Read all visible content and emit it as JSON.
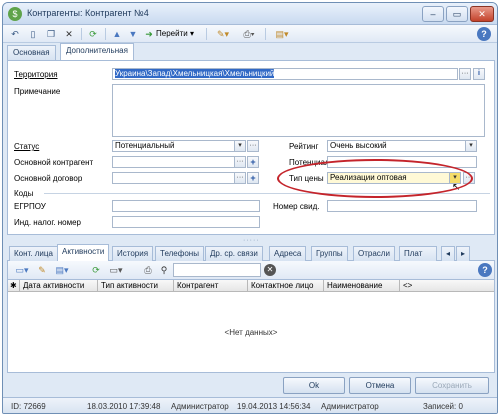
{
  "window": {
    "title": "Контрагенты: Контрагент №4",
    "minimize": "–",
    "maximize": "▭",
    "close": "✕"
  },
  "toolbar": {
    "goto_label": "Перейти",
    "dropdown": "▾"
  },
  "tabs": [
    {
      "label": "Основная"
    },
    {
      "label": "Дополнительная"
    }
  ],
  "form": {
    "territory_label": "Территория",
    "territory_value": "Украина\\Запад\\Хмельницкая\\Хмельницкий",
    "note_label": "Примечание",
    "status_label": "Статус",
    "status_value": "Потенциальный",
    "rating_label": "Рейтинг",
    "rating_value": "Очень высокий",
    "main_contractor_label": "Основной контрагент",
    "potential_label": "Потенциал",
    "main_contract_label": "Основной договор",
    "price_type_label": "Тип цены",
    "price_type_value": "Реализации оптовая",
    "codes_label": "Коды",
    "egrpou_label": "ЕГРПОУ",
    "cert_label": "Номер свид.",
    "tax_label": "Инд. налог. номер"
  },
  "bottom_tabs": [
    {
      "label": "Конт. лица"
    },
    {
      "label": "Активности"
    },
    {
      "label": "История"
    },
    {
      "label": "Телефоны"
    },
    {
      "label": "Др. ср. связи"
    },
    {
      "label": "Адреса"
    },
    {
      "label": "Группы"
    },
    {
      "label": "Отрасли"
    },
    {
      "label": "Плат"
    }
  ],
  "grid": {
    "marker": "✱",
    "columns": [
      "Дата активности",
      "Тип активности",
      "Контрагент",
      "Контактное лицо",
      "Наименование",
      "<>"
    ],
    "empty_text": "<Нет данных>"
  },
  "buttons": {
    "ok": "Ok",
    "cancel": "Отмена",
    "save": "Сохранить"
  },
  "status": {
    "id": "ID: 72669",
    "created_date": "18.03.2010 17:39:48",
    "created_by": "Администратор",
    "modified_date": "19.04.2013 14:56:34",
    "modified_by": "Администратор",
    "records": "Записей: 0"
  },
  "colors": {
    "highlight_oval": "#c4242b",
    "accent": "#1f4fa0",
    "territory_selected": "#3169c6"
  },
  "icons": [
    "app-icon",
    "undo-icon",
    "new-icon",
    "copy-icon",
    "delete-icon",
    "refresh-icon",
    "up-icon",
    "down-icon",
    "tools-icon",
    "print-icon",
    "export-icon",
    "help-icon",
    "search-icon",
    "clear-icon"
  ]
}
